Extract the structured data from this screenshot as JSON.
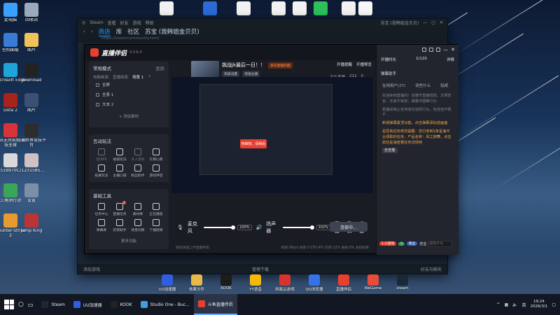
{
  "desktop": {
    "icons_left": [
      {
        "label": "此电脑",
        "icon": "computer-icon",
        "color": "#3aa0ff"
      },
      {
        "label": "回收站",
        "icon": "recycle-bin-icon",
        "color": "#9ab"
      },
      {
        "label": "控制面板",
        "icon": "control-panel-icon",
        "color": "#3a7bd5"
      },
      {
        "label": "图片",
        "icon": "picture-icon",
        "color": "#f0c35a"
      },
      {
        "label": "Microsoft Edge",
        "icon": "edge-icon",
        "color": "#1fa3d8"
      },
      {
        "label": "download",
        "icon": "folder-icon",
        "color": "#222"
      },
      {
        "label": "Dota 2",
        "icon": "dota2-icon",
        "color": "#a8231b"
      },
      {
        "label": "图片",
        "icon": "picture-icon",
        "color": "#3c4f74"
      },
      {
        "label": "腾讯无畏契约-畅玩全球",
        "icon": "game-icon",
        "color": "#d8333a"
      },
      {
        "label": "完美世界竞技平台",
        "icon": "game-icon",
        "color": "#2d2d2d"
      },
      {
        "label": "E51B970C...",
        "icon": "image-file-icon",
        "color": "#d9d9d9"
      },
      {
        "label": "71231585...",
        "icon": "image-file-icon",
        "color": "#cfc0c5"
      },
      {
        "label": "三角洲行动",
        "icon": "game-icon",
        "color": "#3aa657"
      },
      {
        "label": "设置",
        "icon": "settings-icon",
        "color": "#7d8ea8"
      },
      {
        "label": "Counter-Strike 2",
        "icon": "cs2-icon",
        "color": "#e59b2d"
      },
      {
        "label": "Jump King",
        "icon": "game-icon",
        "color": "#b93535"
      }
    ],
    "icons_top": [
      {
        "label": "",
        "icon": "document-icon",
        "color": "#f2f2f2"
      },
      {
        "label": "",
        "icon": "app-icon",
        "color": "#2a6bd6"
      },
      {
        "label": "",
        "icon": "document-icon",
        "color": "#f2f2f2"
      },
      {
        "label": "",
        "icon": "document-icon",
        "color": "#f2f2f2"
      },
      {
        "label": "",
        "icon": "document-icon",
        "color": "#f2f2f2"
      },
      {
        "label": "",
        "icon": "wechat-icon",
        "color": "#2bc058"
      },
      {
        "label": "",
        "icon": "document-icon",
        "color": "#f2f2f2"
      },
      {
        "label": "",
        "icon": "qq-icon",
        "color": "#f7f7f7"
      }
    ],
    "dock": [
      {
        "label": "UU加速器",
        "color": "#2f5fe0"
      },
      {
        "label": "效果文件",
        "color": "#e7b94a"
      },
      {
        "label": "KOOK",
        "color": "#1c1c1c"
      },
      {
        "label": "YY语音",
        "color": "#f5b90b"
      },
      {
        "label": "网易云游戏",
        "color": "#d6352e"
      },
      {
        "label": "QQ浏览器",
        "color": "#3474e8"
      },
      {
        "label": "直播伴侣",
        "color": "#e8402f"
      },
      {
        "label": "WeGame",
        "color": "#e74b3b"
      },
      {
        "label": "steam",
        "color": "#1b2838"
      }
    ]
  },
  "steam": {
    "title": "Steam",
    "menu": [
      "查看",
      "好友",
      "游戏",
      "帮助"
    ],
    "nav": {
      "store": "商店",
      "library": "库",
      "community": "社区",
      "profile": "苏宝 (我韩姐金贝贝)"
    },
    "url": "https://steamcommunity.com/",
    "user": "苏宝 (我韩姐金贝贝)",
    "footer_left": "添加游戏",
    "footer_mid": "管理下载",
    "footer_right": "好友与聊天"
  },
  "app": {
    "logo_text": "直播伴侣",
    "version": "4.3.6.4",
    "mode": "常规模式",
    "mode_right": "竖屏",
    "scene_tabs": [
      "电脑画面",
      "直播画面",
      "场景 1"
    ],
    "sources": [
      "全屏",
      "全景 1",
      "文本 2"
    ],
    "add_source": "+ 添加素材",
    "interact_title": "互动玩法",
    "interact_tools": [
      {
        "label": "连线PK",
        "dim": true
      },
      {
        "label": "福袋玩法",
        "dim": false
      },
      {
        "label": "多人连线",
        "dim": true
      },
      {
        "label": "礼物心愿",
        "dim": false
      },
      {
        "label": "投屏玩法",
        "dim": false
      },
      {
        "label": "主播口袋",
        "dim": false
      },
      {
        "label": "粉丝助手",
        "dim": false
      },
      {
        "label": "游戏伴侣",
        "dim": false
      }
    ],
    "basic_title": "基础工具",
    "basic_tools": [
      {
        "label": "任务中心",
        "badge": ""
      },
      {
        "label": "直播任务",
        "badge": "1"
      },
      {
        "label": "素材库",
        "badge": ""
      },
      {
        "label": "正在播放",
        "badge": ""
      },
      {
        "label": "弹幕库",
        "badge": ""
      },
      {
        "label": "房管助手",
        "badge": ""
      },
      {
        "label": "场景切换",
        "badge": ""
      },
      {
        "label": "下播结束",
        "badge": ""
      }
    ],
    "more": "更多功能",
    "stream_title": "挑战jk最后一日！！",
    "stream_tag": "发布直播封面",
    "stream_chips": [
      "高级设置",
      "快速主播"
    ],
    "top_actions": [
      "开播提醒",
      "开播预览"
    ],
    "stats": {
      "viewers": "212",
      "likes": "0",
      "live": "正在直播"
    },
    "preview_button": "待审核，请稍后",
    "mic_label": "麦克风",
    "mic_value": "100%",
    "speaker_label": "扬声器",
    "speaker_value": "102%",
    "ctrl_labels": [
      "画面",
      "录制",
      "设置"
    ],
    "go_live": "连接中...",
    "status_left": "如何快速上手直播伴侣",
    "status_right": "码率:0Kb/s  帧率:0  CPU:4%  内存:22%  丢帧:0%  本机码率",
    "chat": {
      "title": "开播时长",
      "count": "1/120",
      "extra": "详情",
      "assistant": "弹幕助手",
      "tabs": [
        "在线用户(27)",
        "说些什么",
        "贴纸"
      ],
      "messages": [
        {
          "text": "欢迎来到直播间！请遵守直播规范，文明发言，无良不有效，弹幕作图等行为",
          "warn": false
        },
        {
          "text": "直播间禁止任何违法违规行为，包括但不限于...",
          "warn": false
        },
        {
          "text": "新增弹幕置顶功能，点击弹幕添加进画面",
          "warn": true
        },
        {
          "text": "是否有任务修改提醒：您已收到1条星海平台领取的任务，产品名称：风之旅舞，点击前往星海查看任务详情吧",
          "warn": true
        }
      ],
      "link": "去查看",
      "input_name": "苏宝",
      "input_tags": [
        "1 小游戏",
        "5",
        "粉丝"
      ],
      "input_placeholder": "说些什么",
      "colors": {
        "accent": "#e8402f",
        "warn": "#f5a742"
      }
    }
  },
  "taskbar": {
    "items": [
      {
        "label": "Steam",
        "active": false,
        "color": "#1b2838"
      },
      {
        "label": "UU加速器",
        "active": false,
        "color": "#2f5fe0"
      },
      {
        "label": "KOOK",
        "active": false,
        "color": "#222"
      },
      {
        "label": "Studio One - Buc...",
        "active": false,
        "color": "#3ea0e0"
      },
      {
        "label": "斗鱼直播伴侣",
        "active": true,
        "color": "#e8402f"
      }
    ],
    "time": "19:24",
    "date": "2026/3/1",
    "ime": "英"
  }
}
